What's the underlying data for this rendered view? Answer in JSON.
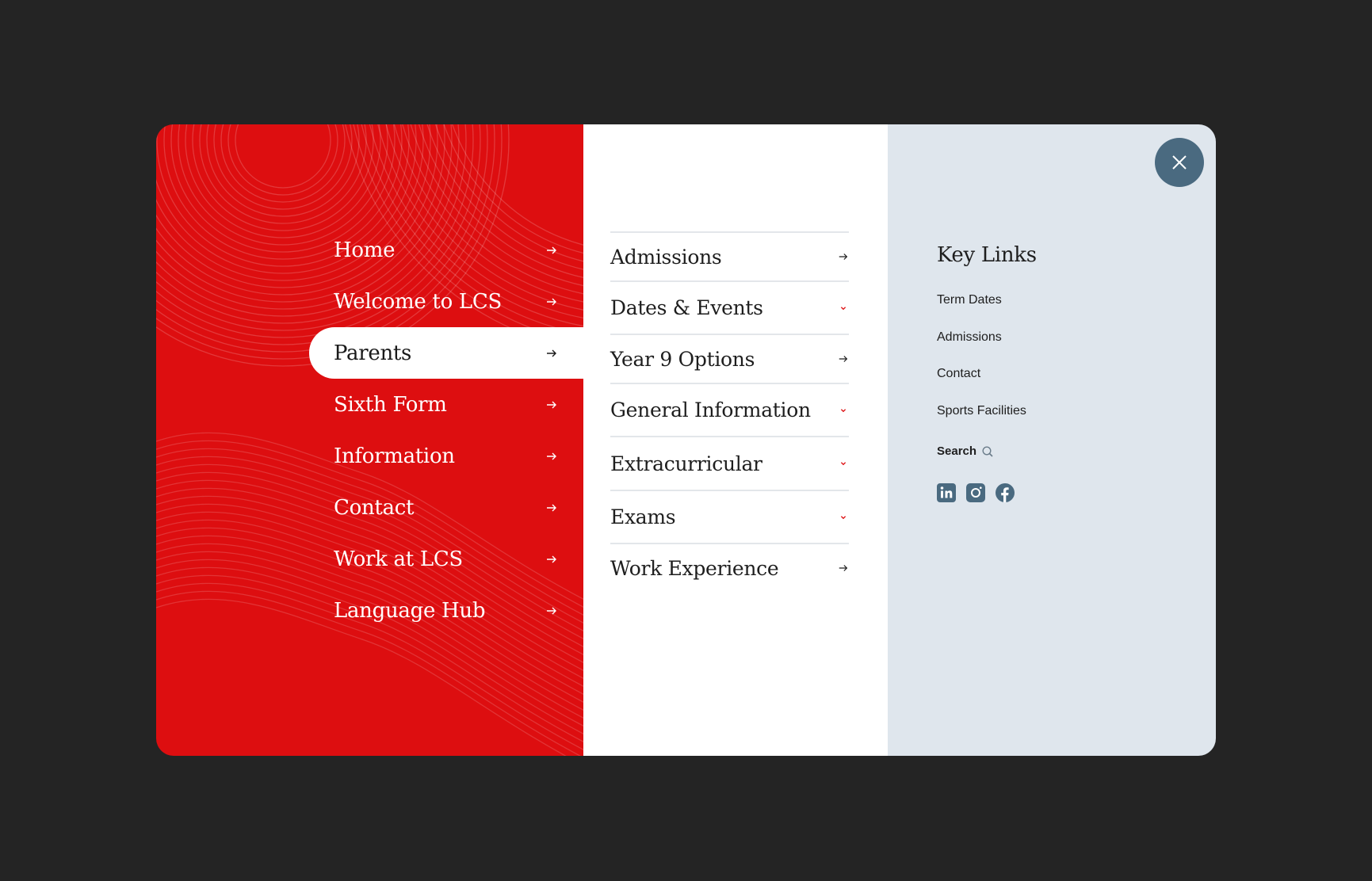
{
  "colors": {
    "page_background": "#242424",
    "primary_panel": "#dd0e10",
    "secondary_panel": "#ffffff",
    "tertiary_panel": "#dfe6ed",
    "close_button": "#4a6a80",
    "accent_chevron": "#dd0e10"
  },
  "primary_nav": {
    "items": [
      {
        "label": "Home",
        "icon": "arrow-right-icon",
        "active": false
      },
      {
        "label": "Welcome to LCS",
        "icon": "arrow-right-icon",
        "active": false
      },
      {
        "label": "Parents",
        "icon": "arrow-right-icon",
        "active": true
      },
      {
        "label": "Sixth Form",
        "icon": "arrow-right-icon",
        "active": false
      },
      {
        "label": "Information",
        "icon": "arrow-right-icon",
        "active": false
      },
      {
        "label": "Contact",
        "icon": "arrow-right-icon",
        "active": false
      },
      {
        "label": "Work at LCS",
        "icon": "arrow-right-icon",
        "active": false
      },
      {
        "label": "Language Hub",
        "icon": "arrow-right-icon",
        "active": false
      }
    ]
  },
  "secondary_nav": {
    "items": [
      {
        "label": "Admissions",
        "icon": "arrow-right-icon"
      },
      {
        "label": "Dates & Events",
        "icon": "chevron-down-icon"
      },
      {
        "label": "Year 9 Options",
        "icon": "arrow-right-icon"
      },
      {
        "label": "General Information",
        "icon": "chevron-down-icon"
      },
      {
        "label": "Extracurricular",
        "icon": "chevron-down-icon"
      },
      {
        "label": "Exams",
        "icon": "chevron-down-icon"
      },
      {
        "label": "Work Experience",
        "icon": "arrow-right-icon"
      }
    ]
  },
  "key_links": {
    "title": "Key Links",
    "links": [
      "Term Dates",
      "Admissions",
      "Contact",
      "Sports Facilities"
    ],
    "search_label": "Search",
    "search_icon": "search-icon",
    "social": [
      "linkedin-icon",
      "instagram-icon",
      "facebook-icon"
    ]
  },
  "close_icon": "close-icon"
}
